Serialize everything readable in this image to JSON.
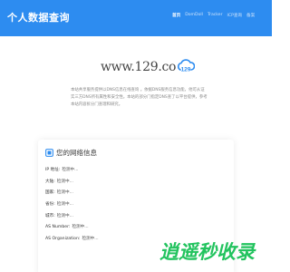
{
  "header": {
    "brand": "个人数据查询",
    "nav": [
      {
        "label": "首页",
        "active": true
      },
      {
        "label": "DomDoll",
        "active": false
      },
      {
        "label": "Tracker",
        "active": false
      },
      {
        "label": "ICP查询",
        "active": false
      },
      {
        "label": "备案",
        "active": false
      }
    ]
  },
  "hero": {
    "logo_text": "www.129.co",
    "badge_text": "129",
    "description": "本站共享服务提供以DNS信息在线查询 。依据DNS服务信息功能，他可从证实三方DNS所有属性和安全性。本站的部分门指定DNS查了以平台提供，参考本站内容拆分门查理和研究。"
  },
  "card": {
    "title": "您的网络信息",
    "rows": [
      {
        "label": "IP 地址:",
        "value": "检测中..."
      },
      {
        "label": "大陆:",
        "value": "检测中..."
      },
      {
        "label": "国家:",
        "value": "检测中..."
      },
      {
        "label": "省份:",
        "value": "检测中..."
      },
      {
        "label": "城市:",
        "value": "检测中..."
      },
      {
        "label": "AS Number:",
        "value": "检测中..."
      },
      {
        "label": "AS Organization:",
        "value": "检测中..."
      }
    ]
  },
  "watermark": "逍遥秒收录",
  "colors": {
    "header_bg": "#2d8cf0",
    "badge_blue": "#2d8cf0",
    "watermark_green": "#22c35e"
  }
}
